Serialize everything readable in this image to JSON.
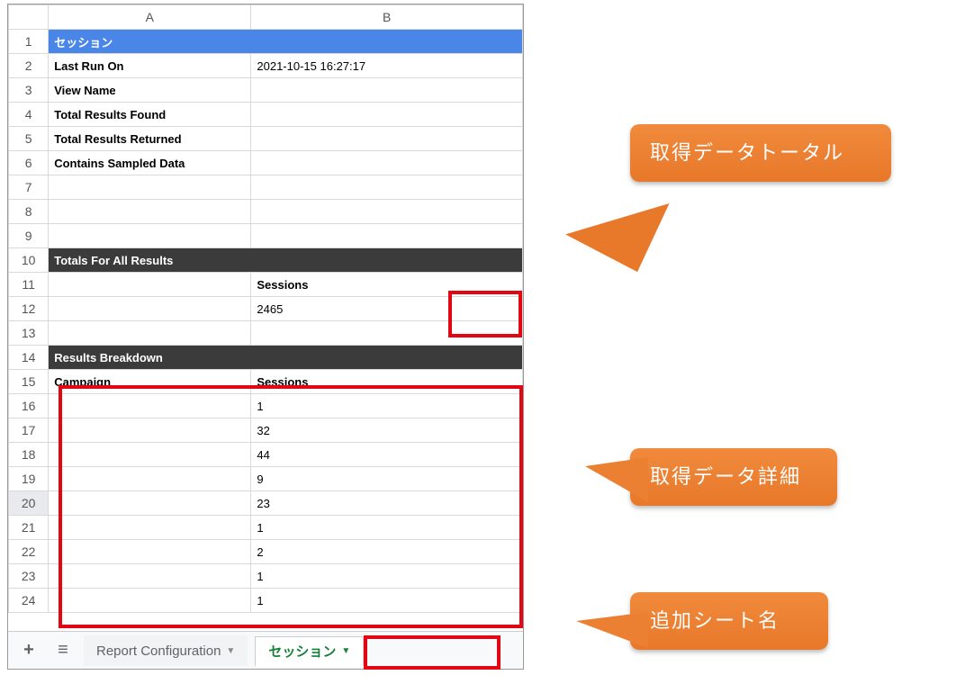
{
  "columns": [
    "A",
    "B"
  ],
  "row_numbers": [
    1,
    2,
    3,
    4,
    5,
    6,
    7,
    8,
    9,
    10,
    11,
    12,
    13,
    14,
    15,
    16,
    17,
    18,
    19,
    20,
    21,
    22,
    23,
    24
  ],
  "rows": {
    "1": {
      "A": "セッション",
      "B": "",
      "merge": true,
      "class": "blue-header"
    },
    "2": {
      "A": "Last Run On",
      "B": "2021-10-15 16:27:17",
      "boldA": true
    },
    "3": {
      "A": "View Name",
      "B": "",
      "boldA": true
    },
    "4": {
      "A": "Total Results Found",
      "B": "",
      "boldA": true
    },
    "5": {
      "A": "Total Results Returned",
      "B": "",
      "boldA": true
    },
    "6": {
      "A": "Contains Sampled Data",
      "B": "",
      "boldA": true
    },
    "7": {
      "A": "",
      "B": ""
    },
    "8": {
      "A": "",
      "B": ""
    },
    "9": {
      "A": "",
      "B": ""
    },
    "10": {
      "A": "Totals For All Results",
      "B": "",
      "merge": true,
      "class": "dark-header"
    },
    "11": {
      "A": "",
      "B": "Sessions",
      "boldB": true,
      "rightB": true
    },
    "12": {
      "A": "",
      "B": "2465",
      "rightB": true
    },
    "13": {
      "A": "",
      "B": ""
    },
    "14": {
      "A": "Results Breakdown",
      "B": "",
      "merge": true,
      "class": "dark-header"
    },
    "15": {
      "A": "Campaign",
      "B": "Sessions",
      "boldA": true,
      "boldB": true,
      "rightB": true
    },
    "16": {
      "A": "",
      "B": "1",
      "rightB": true
    },
    "17": {
      "A": "",
      "B": "32",
      "rightB": true
    },
    "18": {
      "A": "",
      "B": "44",
      "rightB": true
    },
    "19": {
      "A": "",
      "B": "9",
      "rightB": true
    },
    "20": {
      "A": "",
      "B": "23",
      "rightB": true,
      "selected": true
    },
    "21": {
      "A": "",
      "B": "1",
      "rightB": true
    },
    "22": {
      "A": "",
      "B": "2",
      "rightB": true
    },
    "23": {
      "A": "",
      "B": "1",
      "rightB": true
    },
    "24": {
      "A": "",
      "B": "1",
      "rightB": true
    }
  },
  "tabs": {
    "add_label": "+",
    "menu_label": "≡",
    "tab1": "Report Configuration",
    "tab2": "セッション",
    "active": 2
  },
  "callouts": {
    "c1": "取得データトータル",
    "c2": "取得データ詳細",
    "c3": "追加シート名"
  },
  "chart_data": {
    "type": "table",
    "title": "セッション",
    "totals": {
      "Sessions": 2465
    },
    "breakdown": {
      "columns": [
        "Campaign",
        "Sessions"
      ],
      "rows": [
        {
          "Campaign": "",
          "Sessions": 1
        },
        {
          "Campaign": "",
          "Sessions": 32
        },
        {
          "Campaign": "",
          "Sessions": 44
        },
        {
          "Campaign": "",
          "Sessions": 9
        },
        {
          "Campaign": "",
          "Sessions": 23
        },
        {
          "Campaign": "",
          "Sessions": 1
        },
        {
          "Campaign": "",
          "Sessions": 2
        },
        {
          "Campaign": "",
          "Sessions": 1
        },
        {
          "Campaign": "",
          "Sessions": 1
        }
      ]
    },
    "metadata": {
      "Last Run On": "2021-10-15 16:27:17",
      "View Name": "",
      "Total Results Found": "",
      "Total Results Returned": "",
      "Contains Sampled Data": ""
    }
  }
}
